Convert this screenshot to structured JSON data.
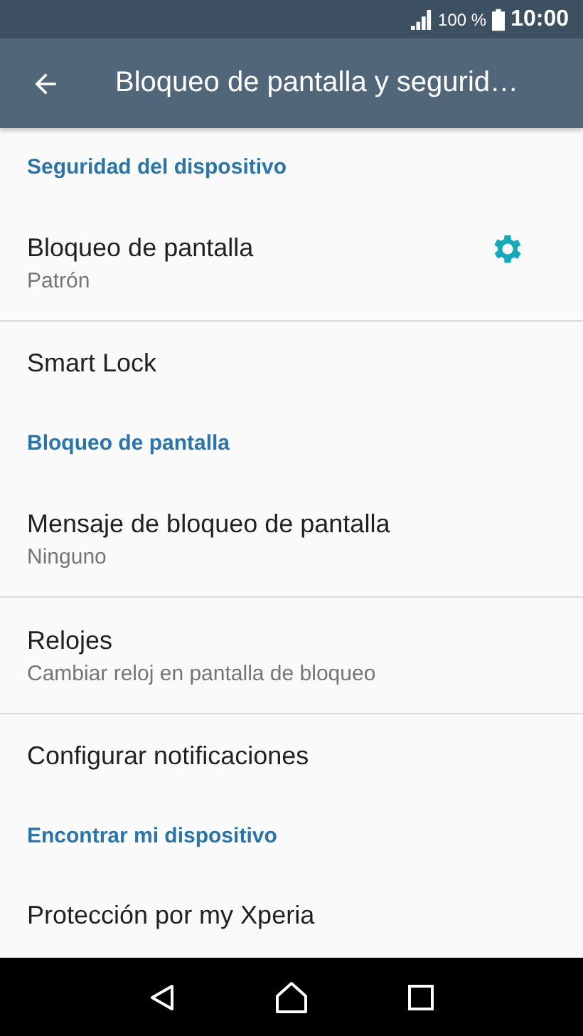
{
  "status_bar": {
    "battery": "100 %",
    "time": "10:00"
  },
  "app_bar": {
    "title": "Bloqueo de pantalla y segurid…"
  },
  "list": [
    {
      "kind": "header",
      "title": "Seguridad del dispositivo"
    },
    {
      "kind": "item",
      "title": "Bloqueo de pantalla",
      "subtitle": "Patrón",
      "settings": true,
      "divider": true
    },
    {
      "kind": "item",
      "title": "Smart Lock",
      "divider": false
    },
    {
      "kind": "header",
      "title": "Bloqueo de pantalla"
    },
    {
      "kind": "item",
      "title": "Mensaje de bloqueo de pantalla",
      "subtitle": "Ninguno",
      "divider": true
    },
    {
      "kind": "item",
      "title": "Relojes",
      "subtitle": "Cambiar reloj en pantalla de bloqueo",
      "divider": true
    },
    {
      "kind": "item",
      "title": "Configurar notificaciones",
      "divider": false
    },
    {
      "kind": "header",
      "title": "Encontrar mi dispositivo"
    },
    {
      "kind": "item",
      "title": "Protección por my Xperia",
      "divider": false
    }
  ]
}
